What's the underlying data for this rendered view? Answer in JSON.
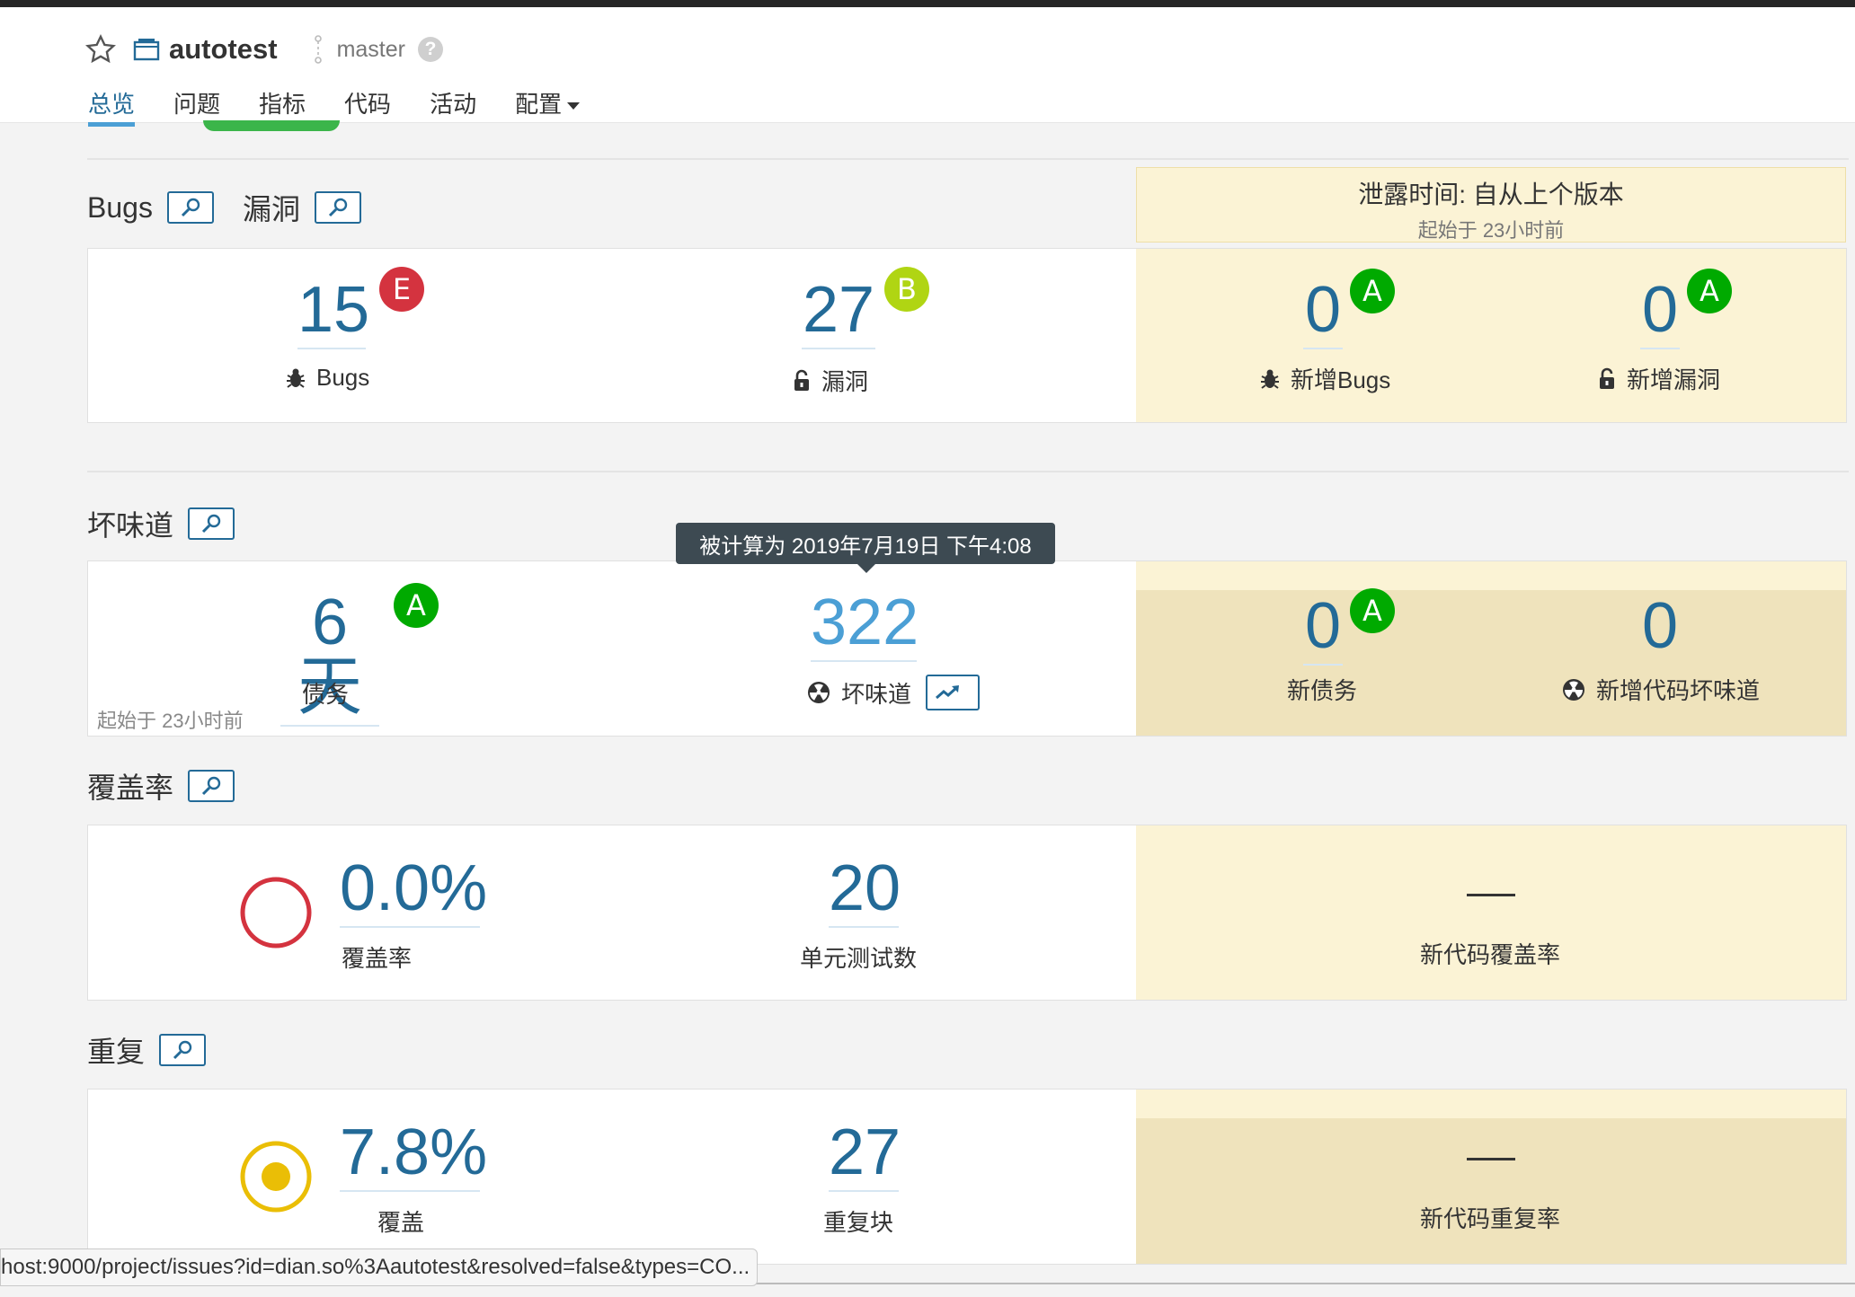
{
  "header": {
    "project_name": "autotest",
    "branch": "master",
    "help": "?",
    "nav": [
      "总览",
      "问题",
      "指标",
      "代码",
      "活动",
      "配置"
    ]
  },
  "leak_period": {
    "title": "泄露时间: 自从上个版本",
    "subtitle": "起始于 23小时前"
  },
  "sections": {
    "bugs_title": "Bugs",
    "vuln_title": "漏洞",
    "smells_title": "坏味道",
    "coverage_title": "覆盖率",
    "dup_title": "重复"
  },
  "bugs": {
    "value": "15",
    "rating": "E",
    "label": "Bugs",
    "vuln_value": "27",
    "vuln_rating": "B",
    "vuln_label": "漏洞",
    "new_bugs_value": "0",
    "new_bugs_rating": "A",
    "new_bugs_label": "新增Bugs",
    "new_vuln_value": "0",
    "new_vuln_rating": "A",
    "new_vuln_label": "新增漏洞"
  },
  "smells": {
    "debt_value": "6天",
    "debt_rating": "A",
    "debt_label": "债务",
    "since": "起始于 23小时前",
    "smells_value": "322",
    "smells_label": "坏味道",
    "tooltip": "被计算为 2019年7月19日 下午4:08",
    "new_debt_value": "0",
    "new_debt_rating": "A",
    "new_debt_label": "新债务",
    "new_smells_value": "0",
    "new_smells_label": "新增代码坏味道"
  },
  "coverage": {
    "value": "0.0%",
    "value_num": 0.0,
    "label": "覆盖率",
    "tests_value": "20",
    "tests_label": "单元测试数",
    "new_value": "—",
    "new_label": "新代码覆盖率"
  },
  "duplications": {
    "value": "7.8%",
    "value_num": 7.8,
    "label": "覆盖",
    "blocks_value": "27",
    "blocks_label": "重复块",
    "new_value": "—",
    "new_label": "新代码重复率"
  },
  "statusbar": {
    "url": "host:9000/project/issues?id=dian.so%3Aautotest&resolved=false&types=CO..."
  },
  "colors": {
    "accent": "#236a97",
    "rating_a": "#00aa00",
    "rating_b": "#b0d513",
    "rating_e": "#d4333f",
    "leak_bg": "#fbf3d5",
    "coverage_ring": "#d4333f",
    "dup_ring": "#eabe06"
  },
  "icons": {
    "star": "star-icon",
    "project": "project-icon",
    "branch": "branch-icon",
    "bug": "bug-icon",
    "lock": "lock-icon",
    "smell": "radiation-icon",
    "search": "search-icon",
    "trend": "trend-icon"
  }
}
